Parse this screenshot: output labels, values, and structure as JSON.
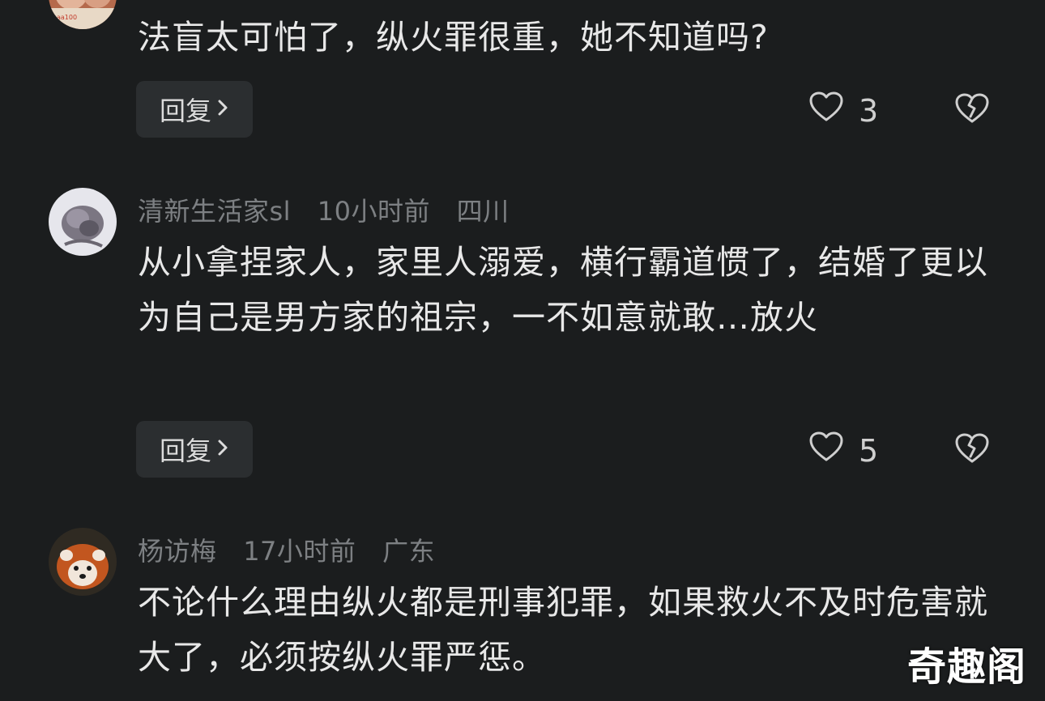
{
  "comments": [
    {
      "content": "法盲太可怕了，纵火罪很重，她不知道吗?",
      "reply_label": "回复",
      "likes": "3"
    },
    {
      "username": "清新生活家sl",
      "time": "10小时前",
      "location": "四川",
      "content": "从小拿捏家人，家里人溺爱，横行霸道惯了，结婚了更以为自己是男方家的祖宗，一不如意就敢…放火",
      "reply_label": "回复",
      "likes": "5"
    },
    {
      "username": "杨访梅",
      "time": "17小时前",
      "location": "广东",
      "content": "不论什么理由纵火都是刑事犯罪，如果救火不及时危害就大了，必须按纵火罪严惩。"
    }
  ],
  "watermark": "奇趣阁",
  "colors": {
    "background": "#1b1d1e",
    "meta_text": "#7d8083",
    "button_bg": "#2b2e30"
  },
  "icons": {
    "reply_chevron": "chevron-right-icon",
    "like": "heart-outline-icon",
    "dislike": "broken-heart-icon"
  }
}
